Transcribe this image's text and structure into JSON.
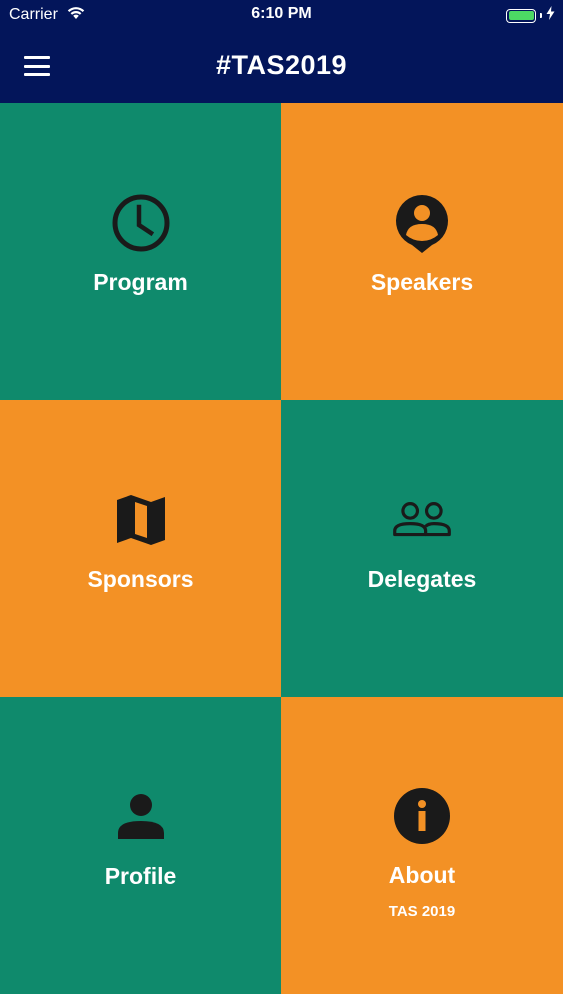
{
  "status_bar": {
    "carrier": "Carrier",
    "time": "6:10 PM",
    "battery_level": 1.0,
    "battery_color": "#4cd964"
  },
  "nav_bar": {
    "title": "#TAS2019",
    "background": "#03155a"
  },
  "colors": {
    "green": "#0f8a6c",
    "orange": "#f39125",
    "icon": "#1a1a1a"
  },
  "tiles": [
    {
      "label": "Program",
      "icon": "clock-icon",
      "color": "green"
    },
    {
      "label": "Speakers",
      "icon": "speaker-pin-icon",
      "color": "orange"
    },
    {
      "label": "Sponsors",
      "icon": "map-icon",
      "color": "orange"
    },
    {
      "label": "Delegates",
      "icon": "people-icon",
      "color": "green"
    },
    {
      "label": "Profile",
      "icon": "person-icon",
      "color": "green"
    },
    {
      "label": "About",
      "sublabel": "TAS 2019",
      "icon": "info-icon",
      "color": "orange"
    }
  ]
}
